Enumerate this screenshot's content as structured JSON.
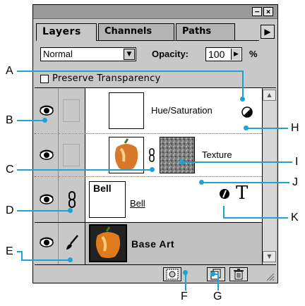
{
  "tabs": [
    "Layers",
    "Channels",
    "Paths"
  ],
  "blend_mode": "Normal",
  "opacity": {
    "label": "Opacity:",
    "value": "100",
    "unit": "%"
  },
  "preserve_transparency": {
    "label": "Preserve Transparency",
    "checked": false
  },
  "layers": [
    {
      "name": "Hue/Saturation",
      "type": "adjustment",
      "visible": true
    },
    {
      "name": "Texture",
      "type": "linked",
      "visible": true
    },
    {
      "name": "Bell",
      "thumb_text": "Bell",
      "type": "text",
      "visible": true
    },
    {
      "name": "Base Art",
      "type": "image",
      "visible": true,
      "selected": true
    }
  ],
  "type_glyph": "T",
  "callouts": [
    "A",
    "B",
    "C",
    "D",
    "E",
    "F",
    "G",
    "H",
    "I",
    "J",
    "K"
  ],
  "colors": {
    "callout": "#1aa3d4",
    "panel": "#c8c8c8",
    "selected_row": "#c0c0c0"
  }
}
